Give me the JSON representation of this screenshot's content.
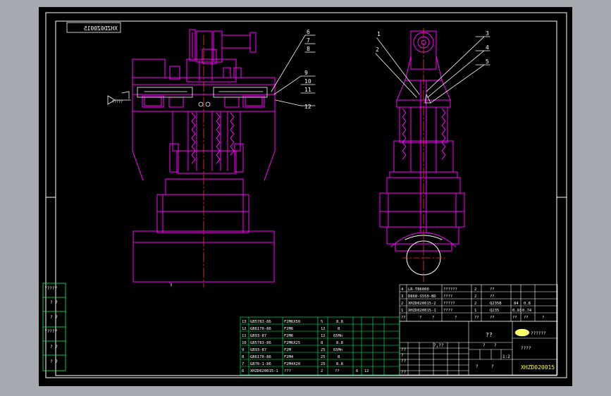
{
  "drawing_number_mirrored": "XHZD0Z0015",
  "drawing_number": "XHZD020015",
  "front_view_callouts": [
    "6",
    "7",
    "8",
    "9",
    "10",
    "11",
    "12"
  ],
  "side_view_callouts": [
    "1",
    "2",
    "3",
    "4",
    "5"
  ],
  "side_margin_labels": [
    "?????",
    "? ?",
    "? ?",
    "?????",
    "? ?",
    "? ?"
  ],
  "small_view_label": "?????",
  "parts_upper": {
    "rows": [
      {
        "no": "4",
        "code": "LR-TB6000",
        "name": "??????",
        "qty": "2",
        "mat": "??",
        "c1": "",
        "c2": ""
      },
      {
        "no": "3",
        "code": "D860-S550-BD",
        "name": "????",
        "qty": "2",
        "mat": "??",
        "c1": "",
        "c2": ""
      },
      {
        "no": "2",
        "code": "XHZD020015-2",
        "name": "?????",
        "qty": "2",
        "mat": "Q235B",
        "c1": "84",
        "c2": "0.8"
      },
      {
        "no": "1",
        "code": "XHZD020015-1",
        "name": "????",
        "qty": "1",
        "mat": "Q235",
        "c1": "0.93",
        "c2": "0.74"
      }
    ],
    "header": [
      "??",
      "?",
      "?",
      "?",
      "??",
      "??",
      "??",
      "??",
      "?"
    ]
  },
  "parts_lower": {
    "rows": [
      {
        "no": "13",
        "code": "GB5783-86",
        "name": "F2M6X50",
        "qty": "5",
        "mat": "8.8"
      },
      {
        "no": "12",
        "code": "GB6170-86",
        "name": "F2M6",
        "qty": "12",
        "mat": "8"
      },
      {
        "no": "11",
        "code": "GB93-87",
        "name": "F2M6",
        "qty": "12",
        "mat": "65Mn"
      },
      {
        "no": "10",
        "code": "GB5783-86",
        "name": "F2M6X25",
        "qty": "8",
        "mat": "8.8"
      },
      {
        "no": "9",
        "code": "GB93-87",
        "name": "F2M",
        "qty": "25",
        "mat": "65Mn"
      },
      {
        "no": "8",
        "code": "GB6170-86",
        "name": "F2M4",
        "qty": "25",
        "mat": "8"
      },
      {
        "no": "7",
        "code": "GB70-1-86",
        "name": "F2M4X20",
        "qty": "25",
        "mat": "8.8"
      },
      {
        "no": "6",
        "code": "XHZD020015-1",
        "name": "???",
        "qty": "2",
        "mat": "??",
        "c1": "6",
        "c2": "12"
      }
    ]
  },
  "title_block": {
    "title": "??",
    "company": "??????",
    "scale_row": [
      "?,??",
      "??",
      "??",
      "??",
      "?"
    ],
    "sheet_label": "????",
    "scale": "1:2",
    "marks": [
      "?",
      "?",
      "?",
      "?"
    ]
  }
}
